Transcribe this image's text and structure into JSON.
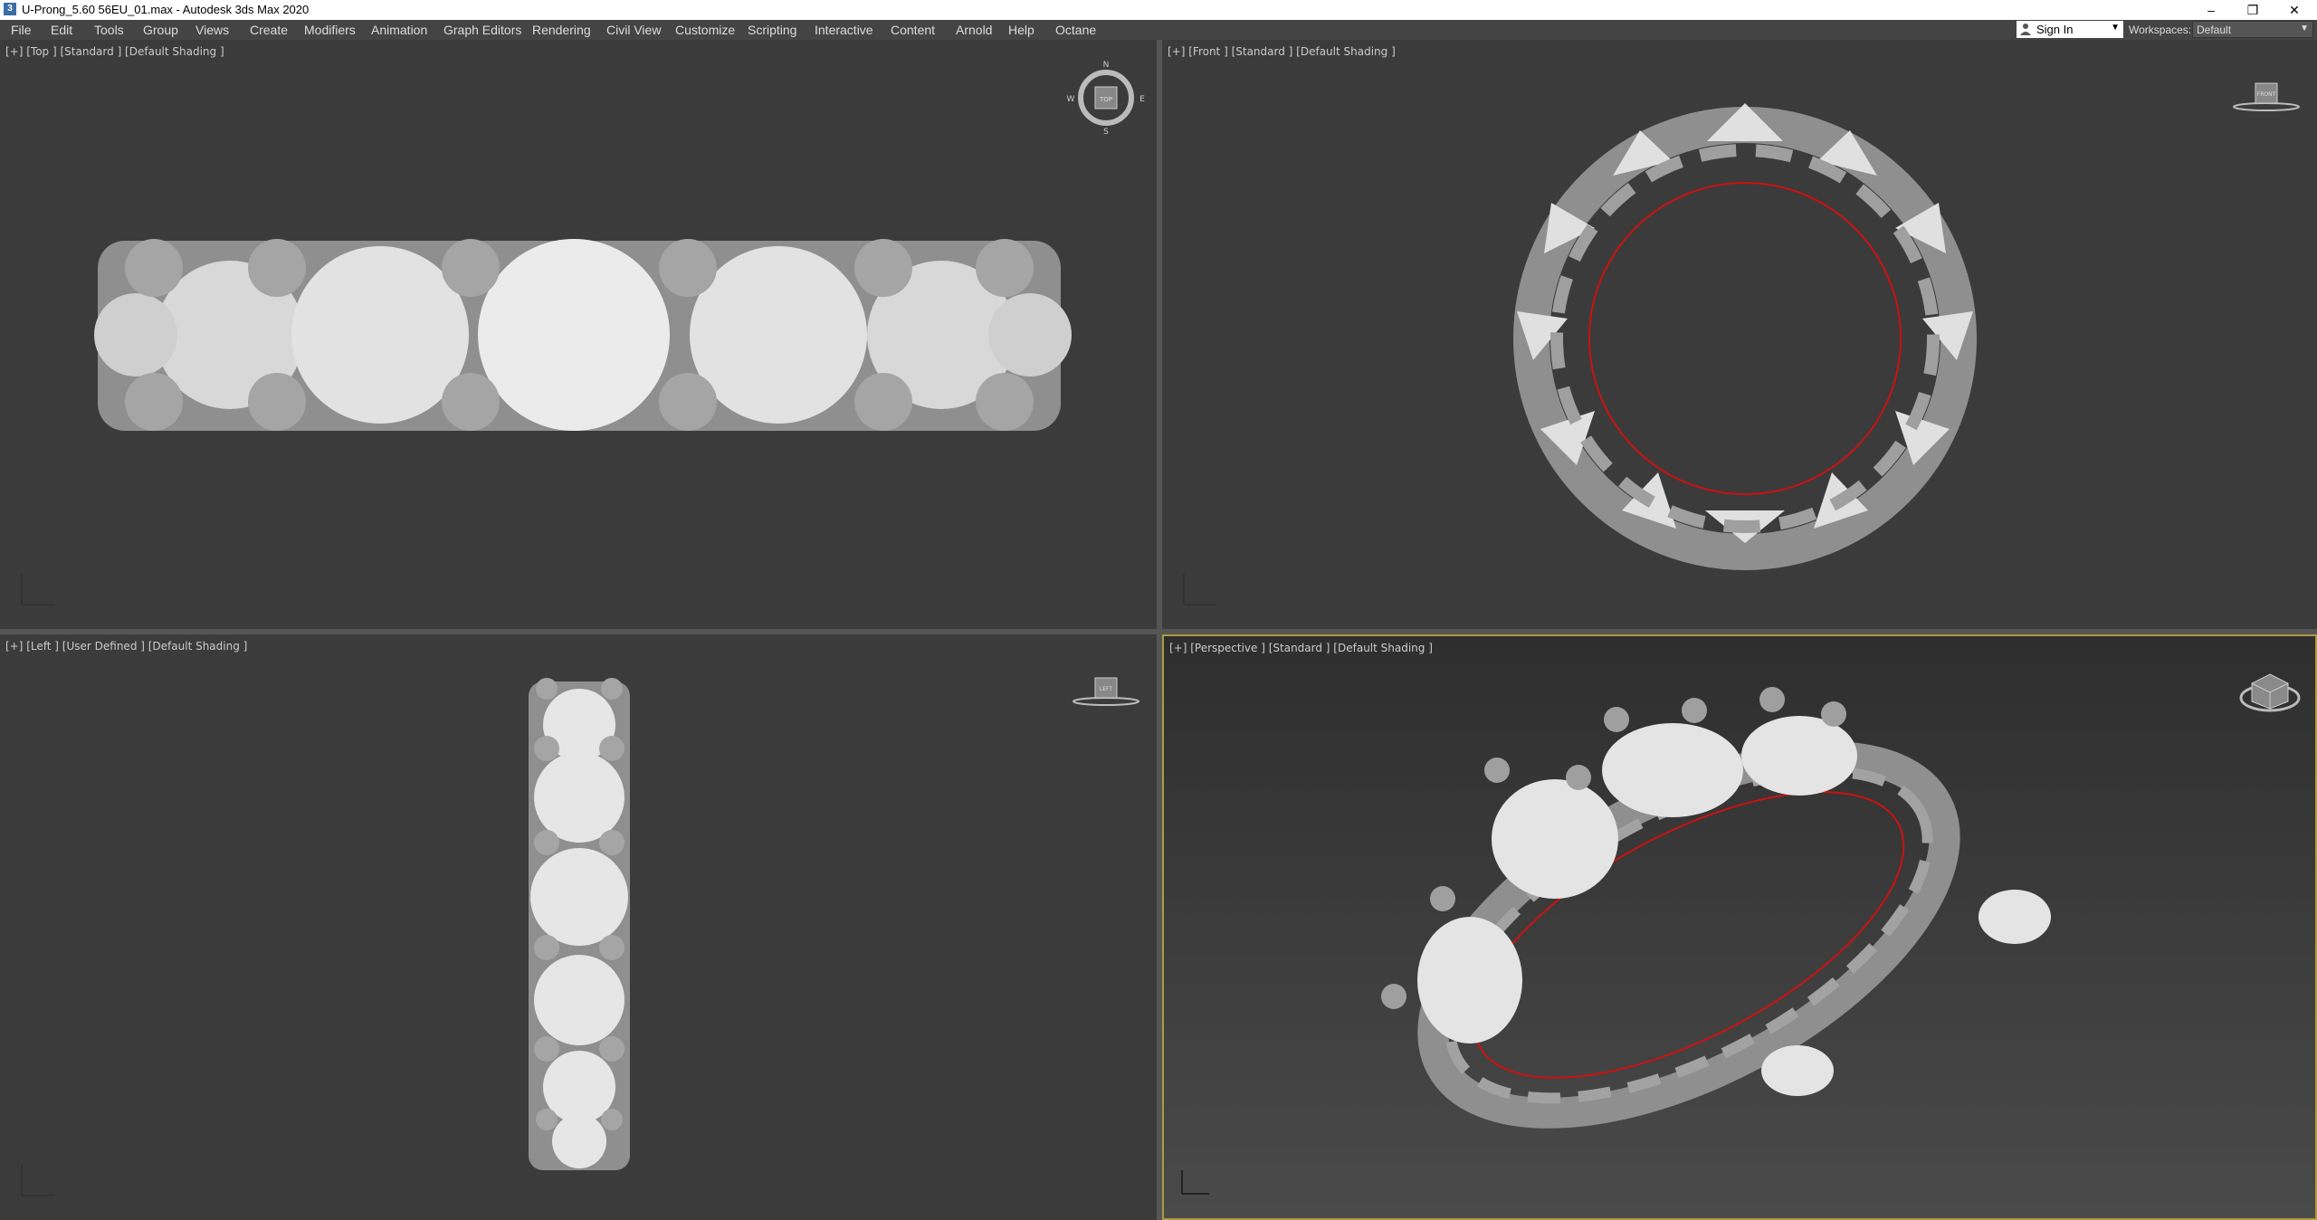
{
  "window": {
    "title": "U-Prong_5.60 56EU_01.max - Autodesk 3ds Max 2020",
    "controls": [
      "–",
      "❐",
      "✕"
    ]
  },
  "menu": {
    "items": [
      "File",
      "Edit",
      "Tools",
      "Group",
      "Views",
      "Create",
      "Modifiers",
      "Animation",
      "Graph Editors",
      "Rendering",
      "Civil View",
      "Customize",
      "Scripting",
      "Interactive",
      "Content",
      "Arnold",
      "Help",
      "Octane"
    ]
  },
  "account": {
    "sign_in": "Sign In",
    "workspaces_label": "Workspaces:",
    "workspace_value": "Default"
  },
  "viewports": {
    "top": {
      "label": "[+] [Top ] [Standard ] [Default Shading ]",
      "compass": {
        "n": "N",
        "s": "S",
        "e": "E",
        "w": "W"
      },
      "cube_face": "TOP"
    },
    "front": {
      "label": "[+] [Front ] [Standard ] [Default Shading ]",
      "cube_face": "FRONT"
    },
    "left": {
      "label": "[+] [Left ] [User Defined ] [Default Shading ]",
      "cube_face": "LEFT"
    },
    "perspective": {
      "label": "[+] [Perspective ] [Standard ] [Default Shading ]",
      "active": true
    }
  },
  "colors": {
    "viewport_bg": "#3b3b3b",
    "active_border": "#b09a40",
    "metal": "#9a9a9a",
    "gem": "#e4e4e4",
    "axis_x": "#cc2222",
    "axis_y": "#22aa22",
    "axis_z": "#2255cc",
    "ring_line": "#cc1111"
  }
}
